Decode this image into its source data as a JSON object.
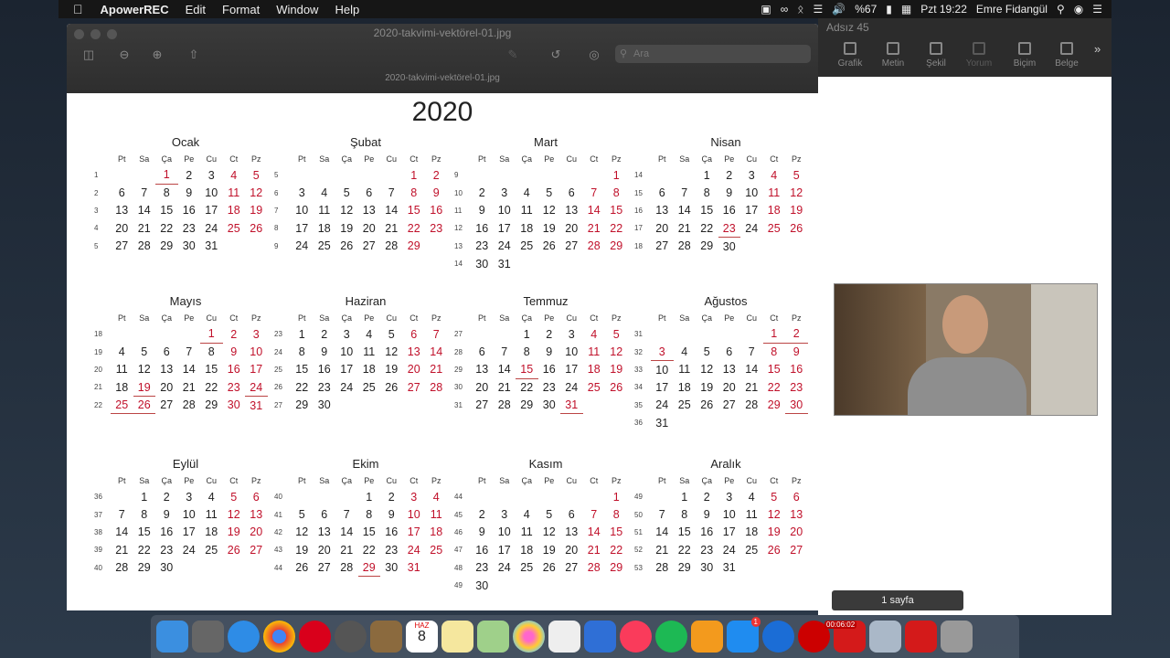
{
  "menubar": {
    "app_name": "ApowerREC",
    "items": [
      "Edit",
      "Format",
      "Window",
      "Help"
    ],
    "battery": "%67",
    "clock": "Pzt 19:22",
    "user": "Emre Fidangül"
  },
  "preview": {
    "window_title": "2020-takvimi-vektörel-01.jpg",
    "doc_title": "2020-takvimi-vektörel-01.jpg",
    "search_placeholder": "Ara"
  },
  "calendar": {
    "year": "2020",
    "weekday_headers": [
      "Pt",
      "Sa",
      "Ça",
      "Pe",
      "Cu",
      "Ct",
      "Pz"
    ],
    "months": [
      {
        "name": "Ocak",
        "rows": [
          {
            "w": "1",
            "d": [
              "",
              "",
              "1",
              "2",
              "3",
              "4",
              "5"
            ]
          },
          {
            "w": "2",
            "d": [
              "6",
              "7",
              "8",
              "9",
              "10",
              "11",
              "12"
            ]
          },
          {
            "w": "3",
            "d": [
              "13",
              "14",
              "15",
              "16",
              "17",
              "18",
              "19"
            ]
          },
          {
            "w": "4",
            "d": [
              "20",
              "21",
              "22",
              "23",
              "24",
              "25",
              "26"
            ]
          },
          {
            "w": "5",
            "d": [
              "27",
              "28",
              "29",
              "30",
              "31",
              "",
              ""
            ]
          }
        ],
        "holidays": [
          "1"
        ]
      },
      {
        "name": "Şubat",
        "rows": [
          {
            "w": "5",
            "d": [
              "",
              "",
              "",
              "",
              "",
              "1",
              "2"
            ]
          },
          {
            "w": "6",
            "d": [
              "3",
              "4",
              "5",
              "6",
              "7",
              "8",
              "9"
            ]
          },
          {
            "w": "7",
            "d": [
              "10",
              "11",
              "12",
              "13",
              "14",
              "15",
              "16"
            ]
          },
          {
            "w": "8",
            "d": [
              "17",
              "18",
              "19",
              "20",
              "21",
              "22",
              "23"
            ]
          },
          {
            "w": "9",
            "d": [
              "24",
              "25",
              "26",
              "27",
              "28",
              "29",
              ""
            ]
          }
        ],
        "holidays": []
      },
      {
        "name": "Mart",
        "rows": [
          {
            "w": "9",
            "d": [
              "",
              "",
              "",
              "",
              "",
              "",
              "1"
            ]
          },
          {
            "w": "10",
            "d": [
              "2",
              "3",
              "4",
              "5",
              "6",
              "7",
              "8"
            ]
          },
          {
            "w": "11",
            "d": [
              "9",
              "10",
              "11",
              "12",
              "13",
              "14",
              "15"
            ]
          },
          {
            "w": "12",
            "d": [
              "16",
              "17",
              "18",
              "19",
              "20",
              "21",
              "22"
            ]
          },
          {
            "w": "13",
            "d": [
              "23",
              "24",
              "25",
              "26",
              "27",
              "28",
              "29"
            ]
          },
          {
            "w": "14",
            "d": [
              "30",
              "31",
              "",
              "",
              "",
              "",
              ""
            ]
          }
        ],
        "holidays": []
      },
      {
        "name": "Nisan",
        "rows": [
          {
            "w": "14",
            "d": [
              "",
              "",
              "1",
              "2",
              "3",
              "4",
              "5"
            ]
          },
          {
            "w": "15",
            "d": [
              "6",
              "7",
              "8",
              "9",
              "10",
              "11",
              "12"
            ]
          },
          {
            "w": "16",
            "d": [
              "13",
              "14",
              "15",
              "16",
              "17",
              "18",
              "19"
            ]
          },
          {
            "w": "17",
            "d": [
              "20",
              "21",
              "22",
              "23",
              "24",
              "25",
              "26"
            ]
          },
          {
            "w": "18",
            "d": [
              "27",
              "28",
              "29",
              "30",
              "",
              "",
              ""
            ]
          }
        ],
        "holidays": [
          "23"
        ]
      },
      {
        "name": "Mayıs",
        "rows": [
          {
            "w": "18",
            "d": [
              "",
              "",
              "",
              "",
              "1",
              "2",
              "3"
            ]
          },
          {
            "w": "19",
            "d": [
              "4",
              "5",
              "6",
              "7",
              "8",
              "9",
              "10"
            ]
          },
          {
            "w": "20",
            "d": [
              "11",
              "12",
              "13",
              "14",
              "15",
              "16",
              "17"
            ]
          },
          {
            "w": "21",
            "d": [
              "18",
              "19",
              "20",
              "21",
              "22",
              "23",
              "24"
            ]
          },
          {
            "w": "22",
            "d": [
              "25",
              "26",
              "27",
              "28",
              "29",
              "30",
              "31"
            ]
          }
        ],
        "holidays": [
          "1",
          "19",
          "24",
          "25",
          "26"
        ]
      },
      {
        "name": "Haziran",
        "rows": [
          {
            "w": "23",
            "d": [
              "1",
              "2",
              "3",
              "4",
              "5",
              "6",
              "7"
            ]
          },
          {
            "w": "24",
            "d": [
              "8",
              "9",
              "10",
              "11",
              "12",
              "13",
              "14"
            ]
          },
          {
            "w": "25",
            "d": [
              "15",
              "16",
              "17",
              "18",
              "19",
              "20",
              "21"
            ]
          },
          {
            "w": "26",
            "d": [
              "22",
              "23",
              "24",
              "25",
              "26",
              "27",
              "28"
            ]
          },
          {
            "w": "27",
            "d": [
              "29",
              "30",
              "",
              "",
              "",
              "",
              ""
            ]
          }
        ],
        "holidays": []
      },
      {
        "name": "Temmuz",
        "rows": [
          {
            "w": "27",
            "d": [
              "",
              "",
              "1",
              "2",
              "3",
              "4",
              "5"
            ]
          },
          {
            "w": "28",
            "d": [
              "6",
              "7",
              "8",
              "9",
              "10",
              "11",
              "12"
            ]
          },
          {
            "w": "29",
            "d": [
              "13",
              "14",
              "15",
              "16",
              "17",
              "18",
              "19"
            ]
          },
          {
            "w": "30",
            "d": [
              "20",
              "21",
              "22",
              "23",
              "24",
              "25",
              "26"
            ]
          },
          {
            "w": "31",
            "d": [
              "27",
              "28",
              "29",
              "30",
              "31",
              "",
              ""
            ]
          }
        ],
        "holidays": [
          "15",
          "31"
        ]
      },
      {
        "name": "Ağustos",
        "rows": [
          {
            "w": "31",
            "d": [
              "",
              "",
              "",
              "",
              "",
              "1",
              "2"
            ]
          },
          {
            "w": "32",
            "d": [
              "3",
              "4",
              "5",
              "6",
              "7",
              "8",
              "9"
            ]
          },
          {
            "w": "33",
            "d": [
              "10",
              "11",
              "12",
              "13",
              "14",
              "15",
              "16"
            ]
          },
          {
            "w": "34",
            "d": [
              "17",
              "18",
              "19",
              "20",
              "21",
              "22",
              "23"
            ]
          },
          {
            "w": "35",
            "d": [
              "24",
              "25",
              "26",
              "27",
              "28",
              "29",
              "30"
            ]
          },
          {
            "w": "36",
            "d": [
              "31",
              "",
              "",
              "",
              "",
              "",
              ""
            ]
          }
        ],
        "holidays": [
          "1",
          "2",
          "3",
          "30"
        ]
      },
      {
        "name": "Eylül",
        "rows": [
          {
            "w": "36",
            "d": [
              "",
              "1",
              "2",
              "3",
              "4",
              "5",
              "6"
            ]
          },
          {
            "w": "37",
            "d": [
              "7",
              "8",
              "9",
              "10",
              "11",
              "12",
              "13"
            ]
          },
          {
            "w": "38",
            "d": [
              "14",
              "15",
              "16",
              "17",
              "18",
              "19",
              "20"
            ]
          },
          {
            "w": "39",
            "d": [
              "21",
              "22",
              "23",
              "24",
              "25",
              "26",
              "27"
            ]
          },
          {
            "w": "40",
            "d": [
              "28",
              "29",
              "30",
              "",
              "",
              "",
              ""
            ]
          }
        ],
        "holidays": []
      },
      {
        "name": "Ekim",
        "rows": [
          {
            "w": "40",
            "d": [
              "",
              "",
              "",
              "1",
              "2",
              "3",
              "4"
            ]
          },
          {
            "w": "41",
            "d": [
              "5",
              "6",
              "7",
              "8",
              "9",
              "10",
              "11"
            ]
          },
          {
            "w": "42",
            "d": [
              "12",
              "13",
              "14",
              "15",
              "16",
              "17",
              "18"
            ]
          },
          {
            "w": "43",
            "d": [
              "19",
              "20",
              "21",
              "22",
              "23",
              "24",
              "25"
            ]
          },
          {
            "w": "44",
            "d": [
              "26",
              "27",
              "28",
              "29",
              "30",
              "31",
              ""
            ]
          }
        ],
        "holidays": [
          "29"
        ]
      },
      {
        "name": "Kasım",
        "rows": [
          {
            "w": "44",
            "d": [
              "",
              "",
              "",
              "",
              "",
              "",
              "1"
            ]
          },
          {
            "w": "45",
            "d": [
              "2",
              "3",
              "4",
              "5",
              "6",
              "7",
              "8"
            ]
          },
          {
            "w": "46",
            "d": [
              "9",
              "10",
              "11",
              "12",
              "13",
              "14",
              "15"
            ]
          },
          {
            "w": "47",
            "d": [
              "16",
              "17",
              "18",
              "19",
              "20",
              "21",
              "22"
            ]
          },
          {
            "w": "48",
            "d": [
              "23",
              "24",
              "25",
              "26",
              "27",
              "28",
              "29"
            ]
          },
          {
            "w": "49",
            "d": [
              "30",
              "",
              "",
              "",
              "",
              "",
              ""
            ]
          }
        ],
        "holidays": []
      },
      {
        "name": "Aralık",
        "rows": [
          {
            "w": "49",
            "d": [
              "",
              "1",
              "2",
              "3",
              "4",
              "5",
              "6"
            ]
          },
          {
            "w": "50",
            "d": [
              "7",
              "8",
              "9",
              "10",
              "11",
              "12",
              "13"
            ]
          },
          {
            "w": "51",
            "d": [
              "14",
              "15",
              "16",
              "17",
              "18",
              "19",
              "20"
            ]
          },
          {
            "w": "52",
            "d": [
              "21",
              "22",
              "23",
              "24",
              "25",
              "26",
              "27"
            ]
          },
          {
            "w": "53",
            "d": [
              "28",
              "29",
              "30",
              "31",
              "",
              "",
              ""
            ]
          }
        ],
        "holidays": []
      }
    ]
  },
  "pages": {
    "doc_title": "Adsız 45",
    "toolbar": [
      "Grafik",
      "Metin",
      "Şekil",
      "Yorum",
      "Biçim",
      "Belge"
    ],
    "page_count": "1 sayfa"
  },
  "dock": {
    "recording_time": "00:06:02",
    "badge": "1",
    "calendar_month": "HAZ",
    "calendar_day": "8"
  }
}
